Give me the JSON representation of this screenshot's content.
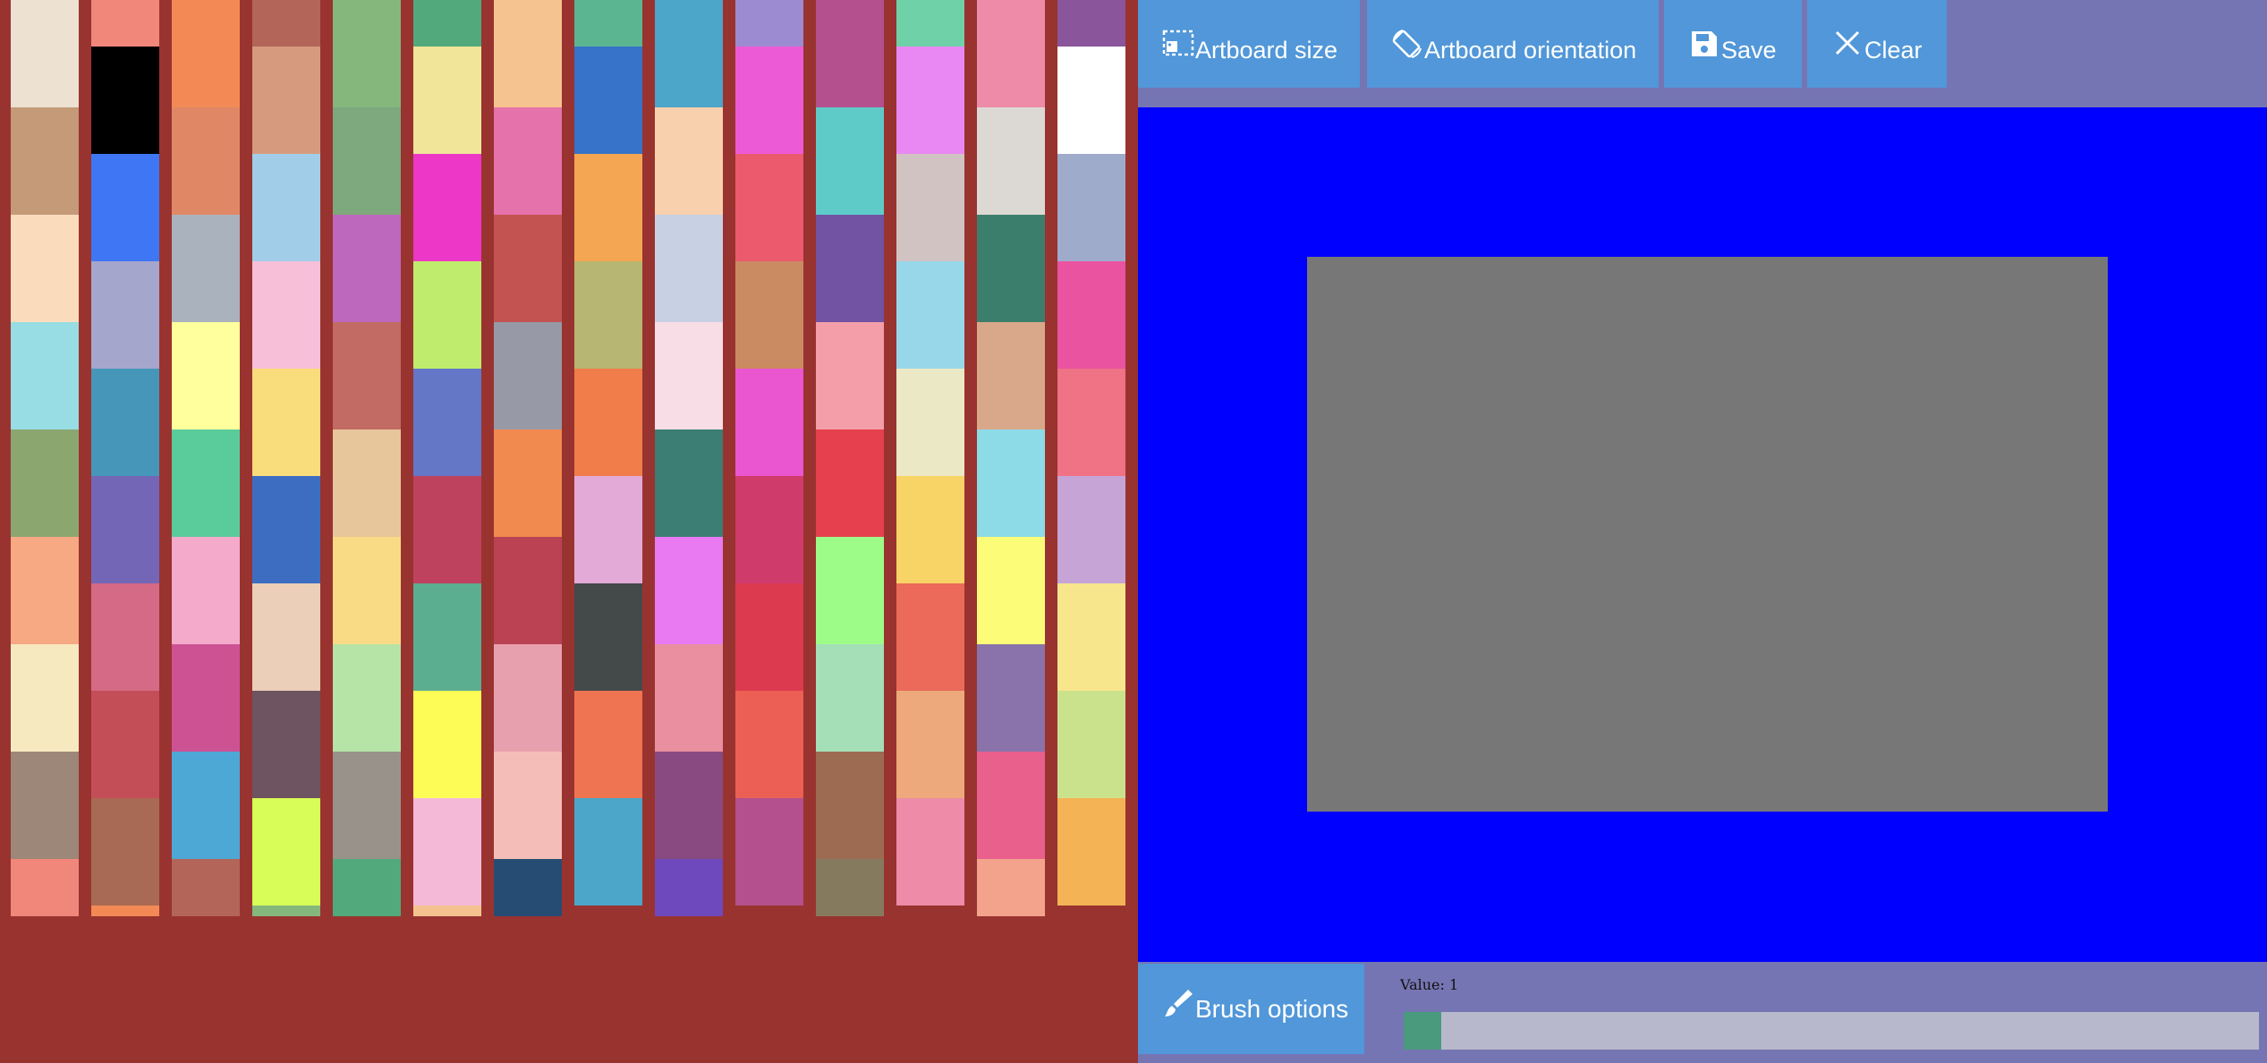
{
  "palette": {
    "colors": [
      [
        "#ede1d2",
        "#c59a79",
        "#fadcbd",
        "#97dde3",
        "#8ca670",
        "#f6a982",
        "#f7e9bf",
        "#9d8778",
        "#f0877a"
      ],
      [
        "#f0877a",
        "#000000",
        "#3f76f4",
        "#a5a6cb",
        "#4696b9",
        "#7366b7",
        "#d56a86",
        "#c34e58",
        "#a86a54",
        "#f38a55"
      ],
      [
        "#f38a55",
        "#e08866",
        "#aab2bd",
        "#ffff9e",
        "#5acb9a",
        "#f4aacb",
        "#cc5294",
        "#4ea8d6",
        "#b26558"
      ],
      [
        "#b26558",
        "#d69b7e",
        "#a2cde8",
        "#f7c0d8",
        "#f9dc7b",
        "#3c6dc1",
        "#ebcfb8",
        "#6d5460",
        "#d8fd58",
        "#85b77c"
      ],
      [
        "#85b77c",
        "#7ea87d",
        "#bd68bd",
        "#c26b65",
        "#e6c69a",
        "#f9db85",
        "#b6e3a6",
        "#99928a",
        "#51a97c"
      ],
      [
        "#51a97c",
        "#f0e598",
        "#ed37c6",
        "#bfec6c",
        "#6477c7",
        "#be425e",
        "#5cae90",
        "#fdfc56",
        "#f3b9d7",
        "#f5c390"
      ],
      [
        "#f5c390",
        "#e672ab",
        "#c35350",
        "#9899a6",
        "#f08a4e",
        "#ba4253",
        "#e7a1ae",
        "#f5bdb7",
        "#264c73"
      ],
      [
        "#5bb590",
        "#3773c8",
        "#f4a653",
        "#b7b673",
        "#f07d4a",
        "#e3aad7",
        "#44494a",
        "#ef7451",
        "#4ba6c9"
      ],
      [
        "#4ba6c9",
        "#f9d0ad",
        "#c8d0e4",
        "#f8dde6",
        "#3c7d74",
        "#e97af2",
        "#e98fa0",
        "#894a81",
        "#6e49bd",
        "#9d8bd1"
      ],
      [
        "#9d8bd1",
        "#ed5ad5",
        "#eb5a6d",
        "#cb8b62",
        "#ea56cf",
        "#cf3b6b",
        "#dc3a4f",
        "#ec5f54",
        "#b3508d"
      ],
      [
        "#b3508d",
        "#5ecbc9",
        "#7252a2",
        "#f39ea9",
        "#e6404e",
        "#9dfc87",
        "#a4dfb7",
        "#9c6b52",
        "#867a5e",
        "#6fd1a7"
      ],
      [
        "#6fd1a7",
        "#ea88f3",
        "#d2c3c3",
        "#98d7ea",
        "#ebe8c6",
        "#f8d366",
        "#eb6a5a",
        "#eda97b",
        "#ed8ba8"
      ],
      [
        "#ed8ba8",
        "#dcd9d4",
        "#3c7e6c",
        "#d9a88a",
        "#8cdbe6",
        "#fcfc78",
        "#8a73aa",
        "#e9608d",
        "#f3a38c",
        "#8a559b"
      ],
      [
        "#8a559b",
        "#ffffff",
        "#9fabca",
        "#ea53a0",
        "#ef7285",
        "#c6a4d6",
        "#f8e68d",
        "#cbe28d",
        "#f4b355"
      ]
    ]
  },
  "toolbar": {
    "artboard_size_label": "Artboard size",
    "artboard_orientation_label": "Artboard orientation",
    "save_label": "Save",
    "clear_label": "Clear"
  },
  "bottom": {
    "brush_options_label": "Brush options",
    "value_label": "Value: 1",
    "slider_value": 1
  },
  "colors": {
    "canvas_background": "#0000ff",
    "artboard": "#777777",
    "accent": "#5197d9",
    "panel": "#7575b3",
    "palette_background": "#993330"
  }
}
